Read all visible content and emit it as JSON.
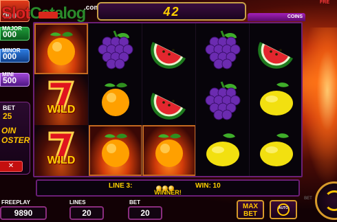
{
  "logo": {
    "slot": "Slot",
    "catalog": "Catalog",
    "com": ".com"
  },
  "jackpots": {
    "top": {
      "label": "",
      "value": "000"
    },
    "major": {
      "label": "MAJOR",
      "value": "000"
    },
    "minor": {
      "label": "MINOR",
      "value": "000"
    },
    "mini": {
      "label": "MINI",
      "value": "500"
    }
  },
  "bonus_panel": {
    "bet_label": "BET",
    "bet_value": "25",
    "boost_line1": "OIN",
    "boost_line2": "OSTER",
    "close_label": "✕"
  },
  "header": {
    "win_value": "42",
    "coins_tab": "COINS",
    "free_tab": "FRE"
  },
  "reels": [
    [
      "orange-fire",
      "seven-wild",
      "seven-wild"
    ],
    [
      "grapes",
      "orange",
      "orange-fire"
    ],
    [
      "watermelon",
      "watermelon",
      "orange-fire"
    ],
    [
      "grapes",
      "grapes",
      "lemon"
    ],
    [
      "watermelon",
      "lemon",
      "lemon"
    ]
  ],
  "wild_label": "WILD",
  "line_info": {
    "line_text": "LINE 3:",
    "win_text": "WIN: 10",
    "winner_text": "WINNER!"
  },
  "bottom": {
    "freeplay_label": "FREEPLAY",
    "freeplay_value": "9890",
    "lines_label": "LINES",
    "lines_value": "20",
    "bet_label": "BET",
    "bet_value": "20",
    "maxbet_line1": "MAX",
    "maxbet_line2": "BET",
    "auto_label": "AUTO",
    "side_bet_label": "BET"
  },
  "colors": {
    "accent_gold": "#ffd000",
    "frame_purple": "#6b1f77",
    "button_border": "#d79a2a"
  }
}
